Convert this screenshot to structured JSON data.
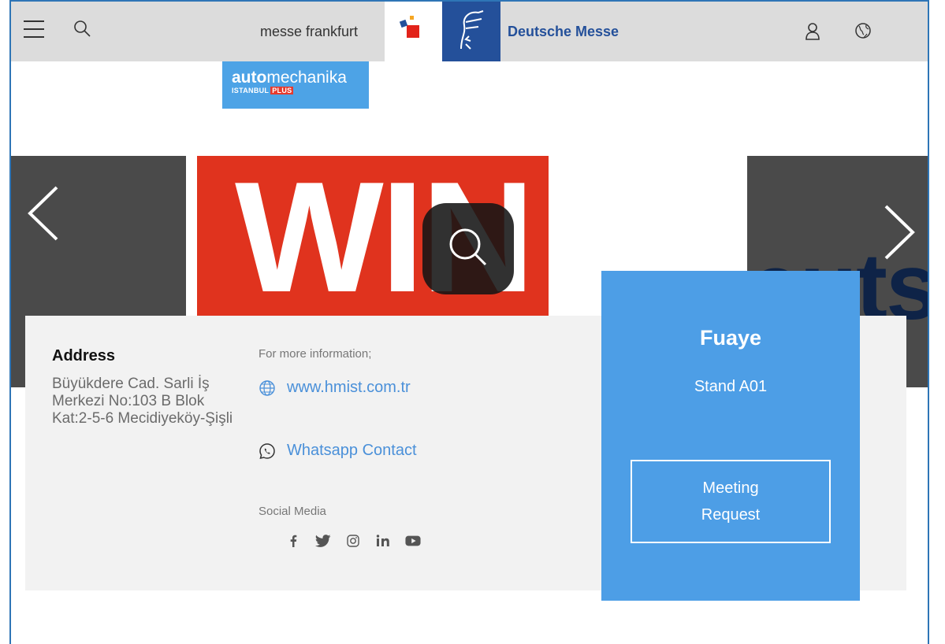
{
  "header": {
    "brand_left": "messe frankfurt",
    "brand_right": "Deutsche Messe",
    "icons": [
      "menu-icon",
      "search-icon",
      "user-icon",
      "globe-icon"
    ]
  },
  "event_logo": {
    "main_bold": "auto",
    "main_rest": "mechanika",
    "sub": "ISTANBUL",
    "sub_tag": "PLUS"
  },
  "carousel": {
    "main_slide_text": "WIN",
    "right_slide_text": "euts",
    "colors": {
      "main_slide": "#e0331e",
      "side_slides": "#4a4a4a"
    }
  },
  "address": {
    "title": "Address",
    "text": "Büyükdere Cad. Sarli İş Merkezi No:103 B Blok Kat:2-5-6 Mecidiyeköy-Şişli"
  },
  "contact": {
    "more_info_label": "For more information;",
    "website": "www.hmist.com.tr",
    "whatsapp": "Whatsapp Contact",
    "social_label": "Social Media",
    "social_icons": [
      "facebook-icon",
      "twitter-icon",
      "instagram-icon",
      "linkedin-icon",
      "youtube-icon"
    ]
  },
  "stand": {
    "hall": "Fuaye",
    "stand": "Stand A01",
    "meeting_button": "Meeting Request",
    "color": "#4d9ee6"
  }
}
